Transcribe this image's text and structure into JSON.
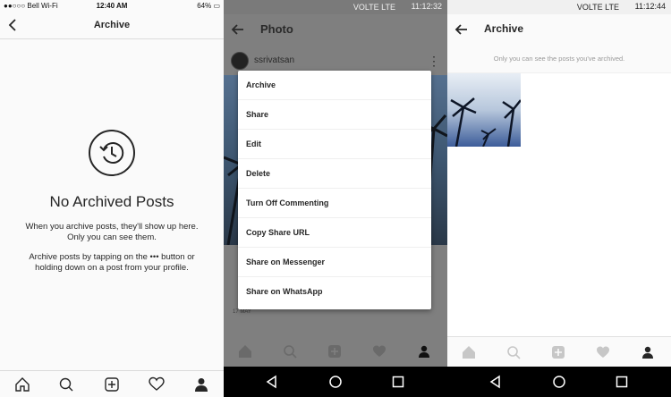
{
  "ios": {
    "status": {
      "carrier": "●●○○○ Bell Wi-Fi",
      "time": "12:40 AM",
      "battery": "64%"
    },
    "header": {
      "title": "Archive"
    },
    "empty": {
      "title": "No Archived Posts",
      "line1": "When you archive posts, they'll show up here. Only you can see them.",
      "line2": "Archive posts by tapping on the ••• button or holding down on a post from your profile."
    },
    "tabs": [
      "home-icon",
      "search-icon",
      "add-icon",
      "heart-icon",
      "profile-icon"
    ]
  },
  "android_dialog": {
    "status": {
      "time": "11:12:32",
      "indicators": "VOLTE  LTE"
    },
    "header": {
      "title": "Photo"
    },
    "post": {
      "username": "ssrivatsan",
      "date": "17 MAY"
    },
    "menu": [
      "Archive",
      "Share",
      "Edit",
      "Delete",
      "Turn Off Commenting",
      "Copy Share URL",
      "Share on Messenger",
      "Share on WhatsApp"
    ]
  },
  "android_archive": {
    "status": {
      "time": "11:12:44",
      "indicators": "VOLTE  LTE"
    },
    "header": {
      "title": "Archive"
    },
    "note": "Only you can see the posts you've archived."
  },
  "colors": {
    "ink": "#262626",
    "border": "#dbdbdb",
    "dim_overlay": "#7f7f7f"
  }
}
